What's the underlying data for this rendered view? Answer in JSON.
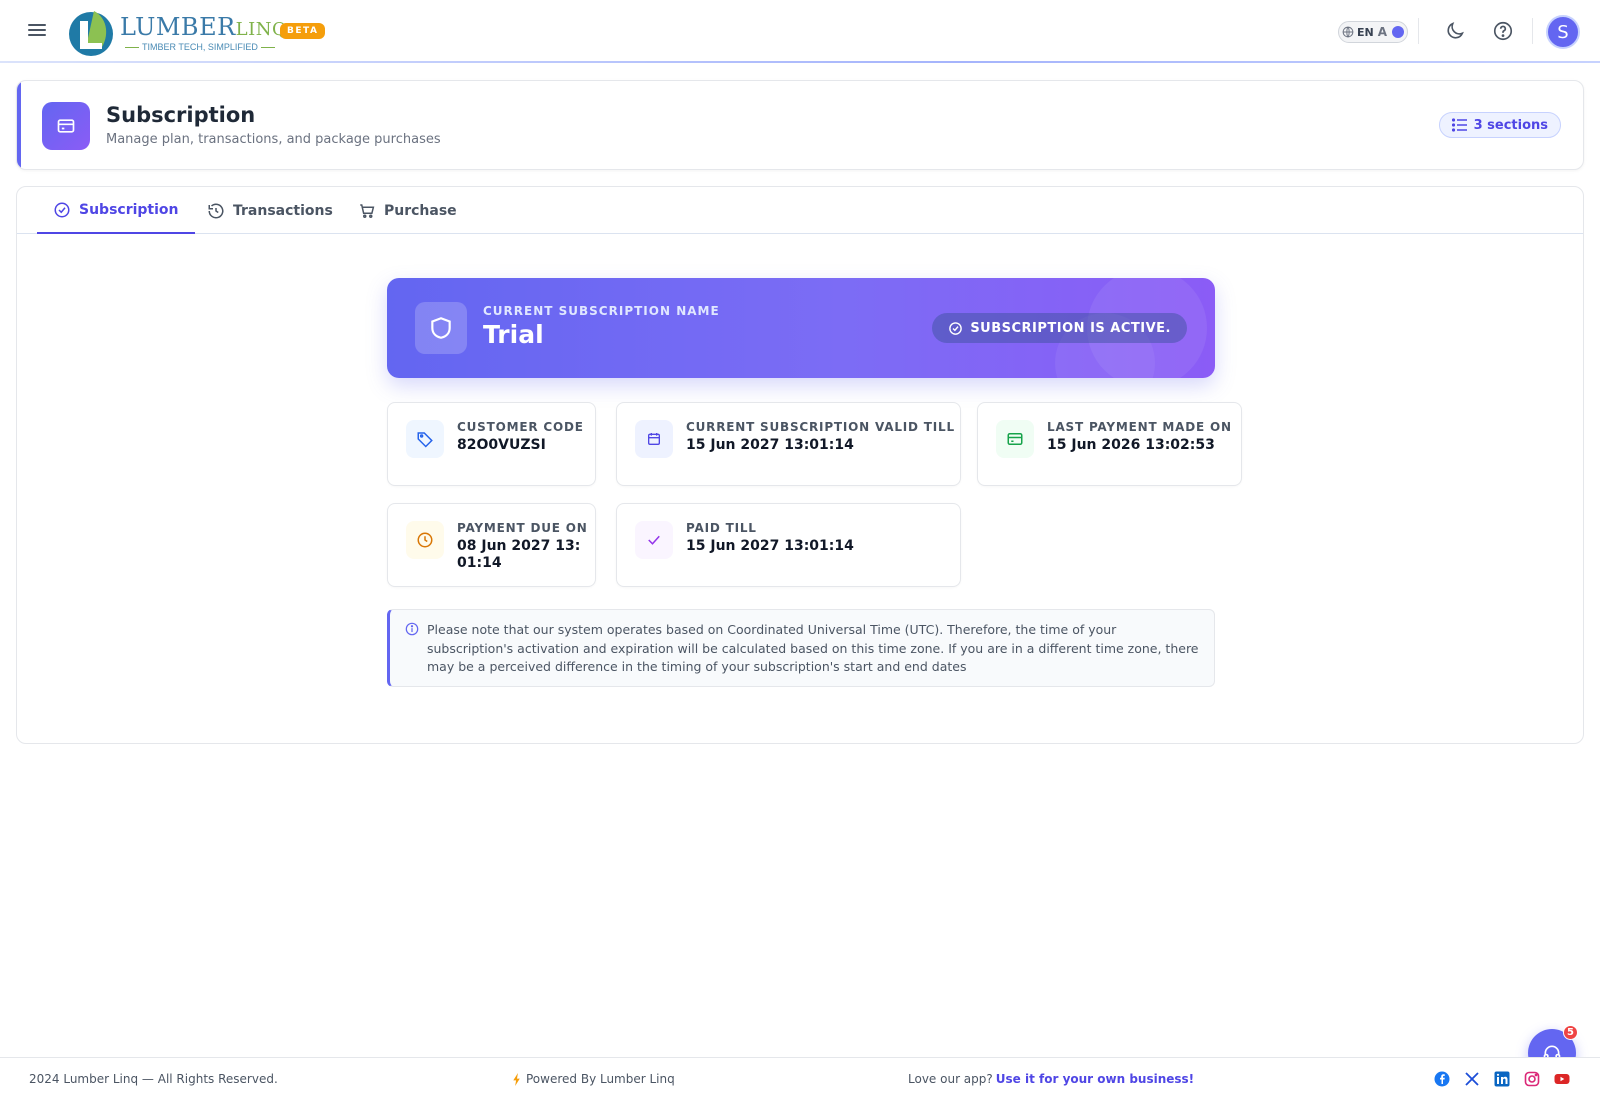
{
  "header": {
    "logo_text_main": "LUMBER",
    "logo_text_accent": "LINQ",
    "logo_tagline": "TIMBER TECH, SIMPLIFIED",
    "beta_badge": "BETA",
    "language": "EN",
    "language_alt": "A",
    "avatar_initial": "S"
  },
  "page": {
    "title": "Subscription",
    "subtitle": "Manage plan, transactions, and package purchases",
    "sections_pill": "3 sections"
  },
  "tabs": [
    {
      "label": "Subscription",
      "active": true
    },
    {
      "label": "Transactions",
      "active": false
    },
    {
      "label": "Purchase",
      "active": false
    }
  ],
  "subscription": {
    "name_label": "CURRENT SUBSCRIPTION NAME",
    "name": "Trial",
    "status": "SUBSCRIPTION IS ACTIVE."
  },
  "info_cards": [
    {
      "label": "CUSTOMER CODE",
      "value": "82O0VUZSI",
      "icon": "tag-icon",
      "color": "#2563eb"
    },
    {
      "label": "CURRENT SUBSCRIPTION VALID TILL",
      "value": "15 Jun 2027 13:01:14",
      "icon": "calendar-icon",
      "color": "#4f46e5"
    },
    {
      "label": "LAST PAYMENT MADE ON",
      "value": "15 Jun 2026 13:02:53",
      "icon": "credit-card-icon",
      "color": "#16a34a"
    },
    {
      "label": "PAYMENT DUE ON",
      "value": "08 Jun 2027 13:01:14",
      "icon": "clock-icon",
      "color": "#d97706"
    },
    {
      "label": "PAID TILL",
      "value": "15 Jun 2027 13:01:14",
      "icon": "check-icon",
      "color": "#9333ea"
    }
  ],
  "note": "Please note that our system operates based on Coordinated Universal Time (UTC). Therefore, the time of your subscription's activation and expiration will be calculated based on this time zone. If you are in a different time zone, there may be a perceived difference in the timing of your subscription's start and end dates",
  "footer": {
    "copyright": "2024 Lumber Linq — All Rights Reserved.",
    "powered": "Powered By Lumber Linq",
    "love_text": "Love our app?",
    "love_link": "Use it for your own business!"
  },
  "support_badge": "5",
  "colors": {
    "accent": "#6366f1",
    "beta": "#f59e0b",
    "badge": "#ef4444"
  }
}
